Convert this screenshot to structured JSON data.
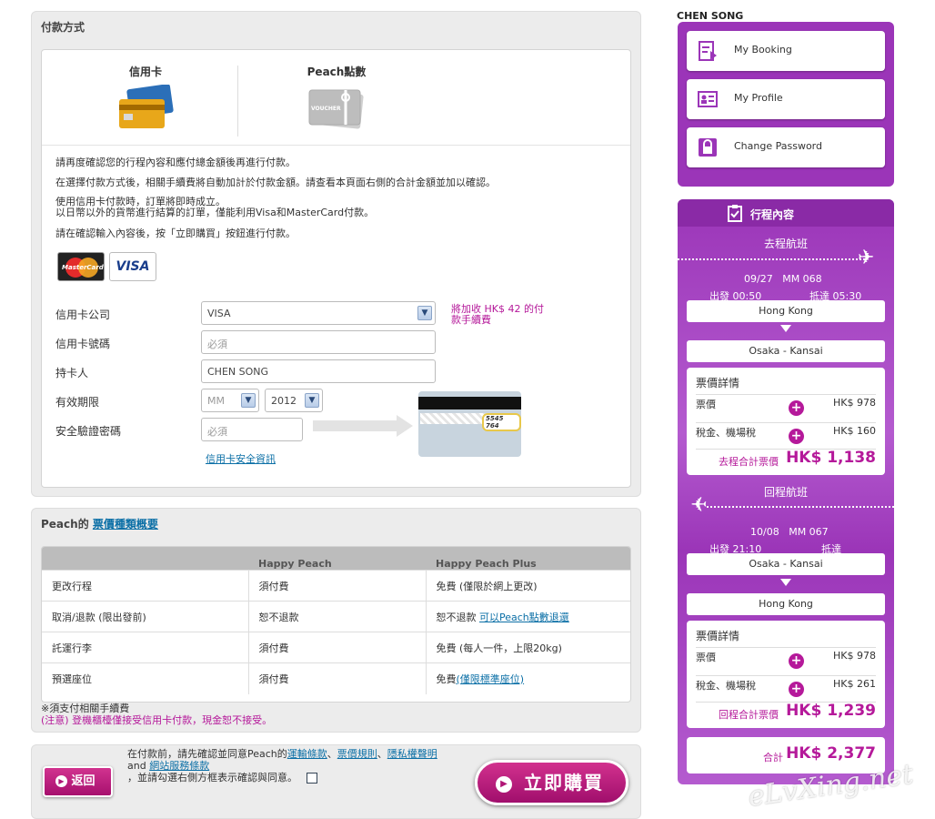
{
  "payment": {
    "title": "付款方式",
    "tab_credit": "信用卡",
    "tab_peach": "Peach點數",
    "voucher_text": "VOUCHER",
    "notes": [
      "請再度確認您的行程內容和應付總金額後再進行付款。",
      "在選擇付款方式後，相關手續費將自動加計於付款金額。請查看本頁面右側的合計金額並加以確認。",
      "使用信用卡付款時，訂單將即時成立。",
      "以日幣以外的貨幣進行結算的訂單，僅能利用Visa和MasterCard付款。",
      "請在確認輸入內容後，按「立即購買」按鈕進行付款。"
    ],
    "mastercard_text": "MasterCard",
    "visa_text": "VISA",
    "labels": {
      "company": "信用卡公司",
      "number": "信用卡號碼",
      "holder": "持卡人",
      "expiry": "有效期限",
      "cvv": "安全驗證密碼"
    },
    "company_value": "VISA",
    "fee_note": "將加收 HK$ 42 的付款手續費",
    "number_placeholder": "必須",
    "holder_value": "CHEN SONG",
    "expiry_month": "MM",
    "expiry_year": "2012",
    "cvv_placeholder": "必須",
    "card_digits": "5545 764",
    "security_link": "信用卡安全資訊"
  },
  "fare_types": {
    "title_prefix": "Peach的 ",
    "title_link": "票價種類概要",
    "headers": [
      "",
      "Happy Peach",
      "Happy Peach Plus"
    ],
    "rows": [
      {
        "item": "更改行程",
        "happy": "須付費",
        "plus": "免費 (僅限於網上更改)",
        "plus_link": ""
      },
      {
        "item": "取消/退款 (限出發前)",
        "happy": "恕不退款",
        "plus": "恕不退款 ",
        "plus_link": "可以Peach點數退還"
      },
      {
        "item": "託運行李",
        "happy": "須付費",
        "plus": "免費 (每人一件，上限20kg)",
        "plus_link": ""
      },
      {
        "item": "預選座位",
        "happy": "須付費",
        "plus": "免費",
        "plus_link": "(僅限標準座位)"
      }
    ],
    "footnote1": "※須支付相關手續費",
    "footnote2": "(注意) 登機櫃檯僅接受信用卡付款，現金恕不接受。"
  },
  "bottom": {
    "back": "返回",
    "agree_line1_pre": "在付款前，請先確認並同意Peach的",
    "link_transport": "運輸條款",
    "sep1": "、",
    "link_fare_rules": "票價規則",
    "sep2": "、",
    "link_privacy": "隱私權聲明",
    "and": " and ",
    "link_site_terms": "網站服務條款",
    "agree_line3": "，並請勾選右側方框表示確認與同意。",
    "buy": "立即購買"
  },
  "user": {
    "name": "CHEN SONG",
    "menu": [
      "My Booking",
      "My Profile",
      "Change Password"
    ]
  },
  "itinerary": {
    "title": "行程內容",
    "outbound": {
      "label": "去程航班",
      "date": "09/27",
      "flight": "MM  068",
      "depart": "出發  00:50",
      "arrive": "抵達  05:30",
      "from": "Hong Kong",
      "to": "Osaka - Kansai",
      "fare_title": "票價詳情",
      "fare_label": "票價",
      "fare_value": "HK$ 978",
      "tax_label": "稅金、機場稅",
      "tax_value": "HK$ 160",
      "total_label": "去程合計票價",
      "total_value": "HK$ 1,138"
    },
    "return": {
      "label": "回程航班",
      "date": "10/08",
      "flight": "MM  067",
      "depart": "出發  21:10",
      "arrive": "抵達",
      "from": "Osaka - Kansai",
      "to": "Hong Kong",
      "fare_title": "票價詳情",
      "fare_label": "票價",
      "fare_value": "HK$ 978",
      "tax_label": "稅金、機場稅",
      "tax_value": "HK$ 261",
      "total_label": "回程合計票價",
      "total_value": "HK$ 1,239"
    },
    "grand_label": "合計",
    "grand_value": "HK$ 2,377"
  },
  "watermark": "eLvXing.net",
  "colors": {
    "brand": "#9b35b8",
    "accent": "#b5199a",
    "link": "#0b6fa6"
  }
}
